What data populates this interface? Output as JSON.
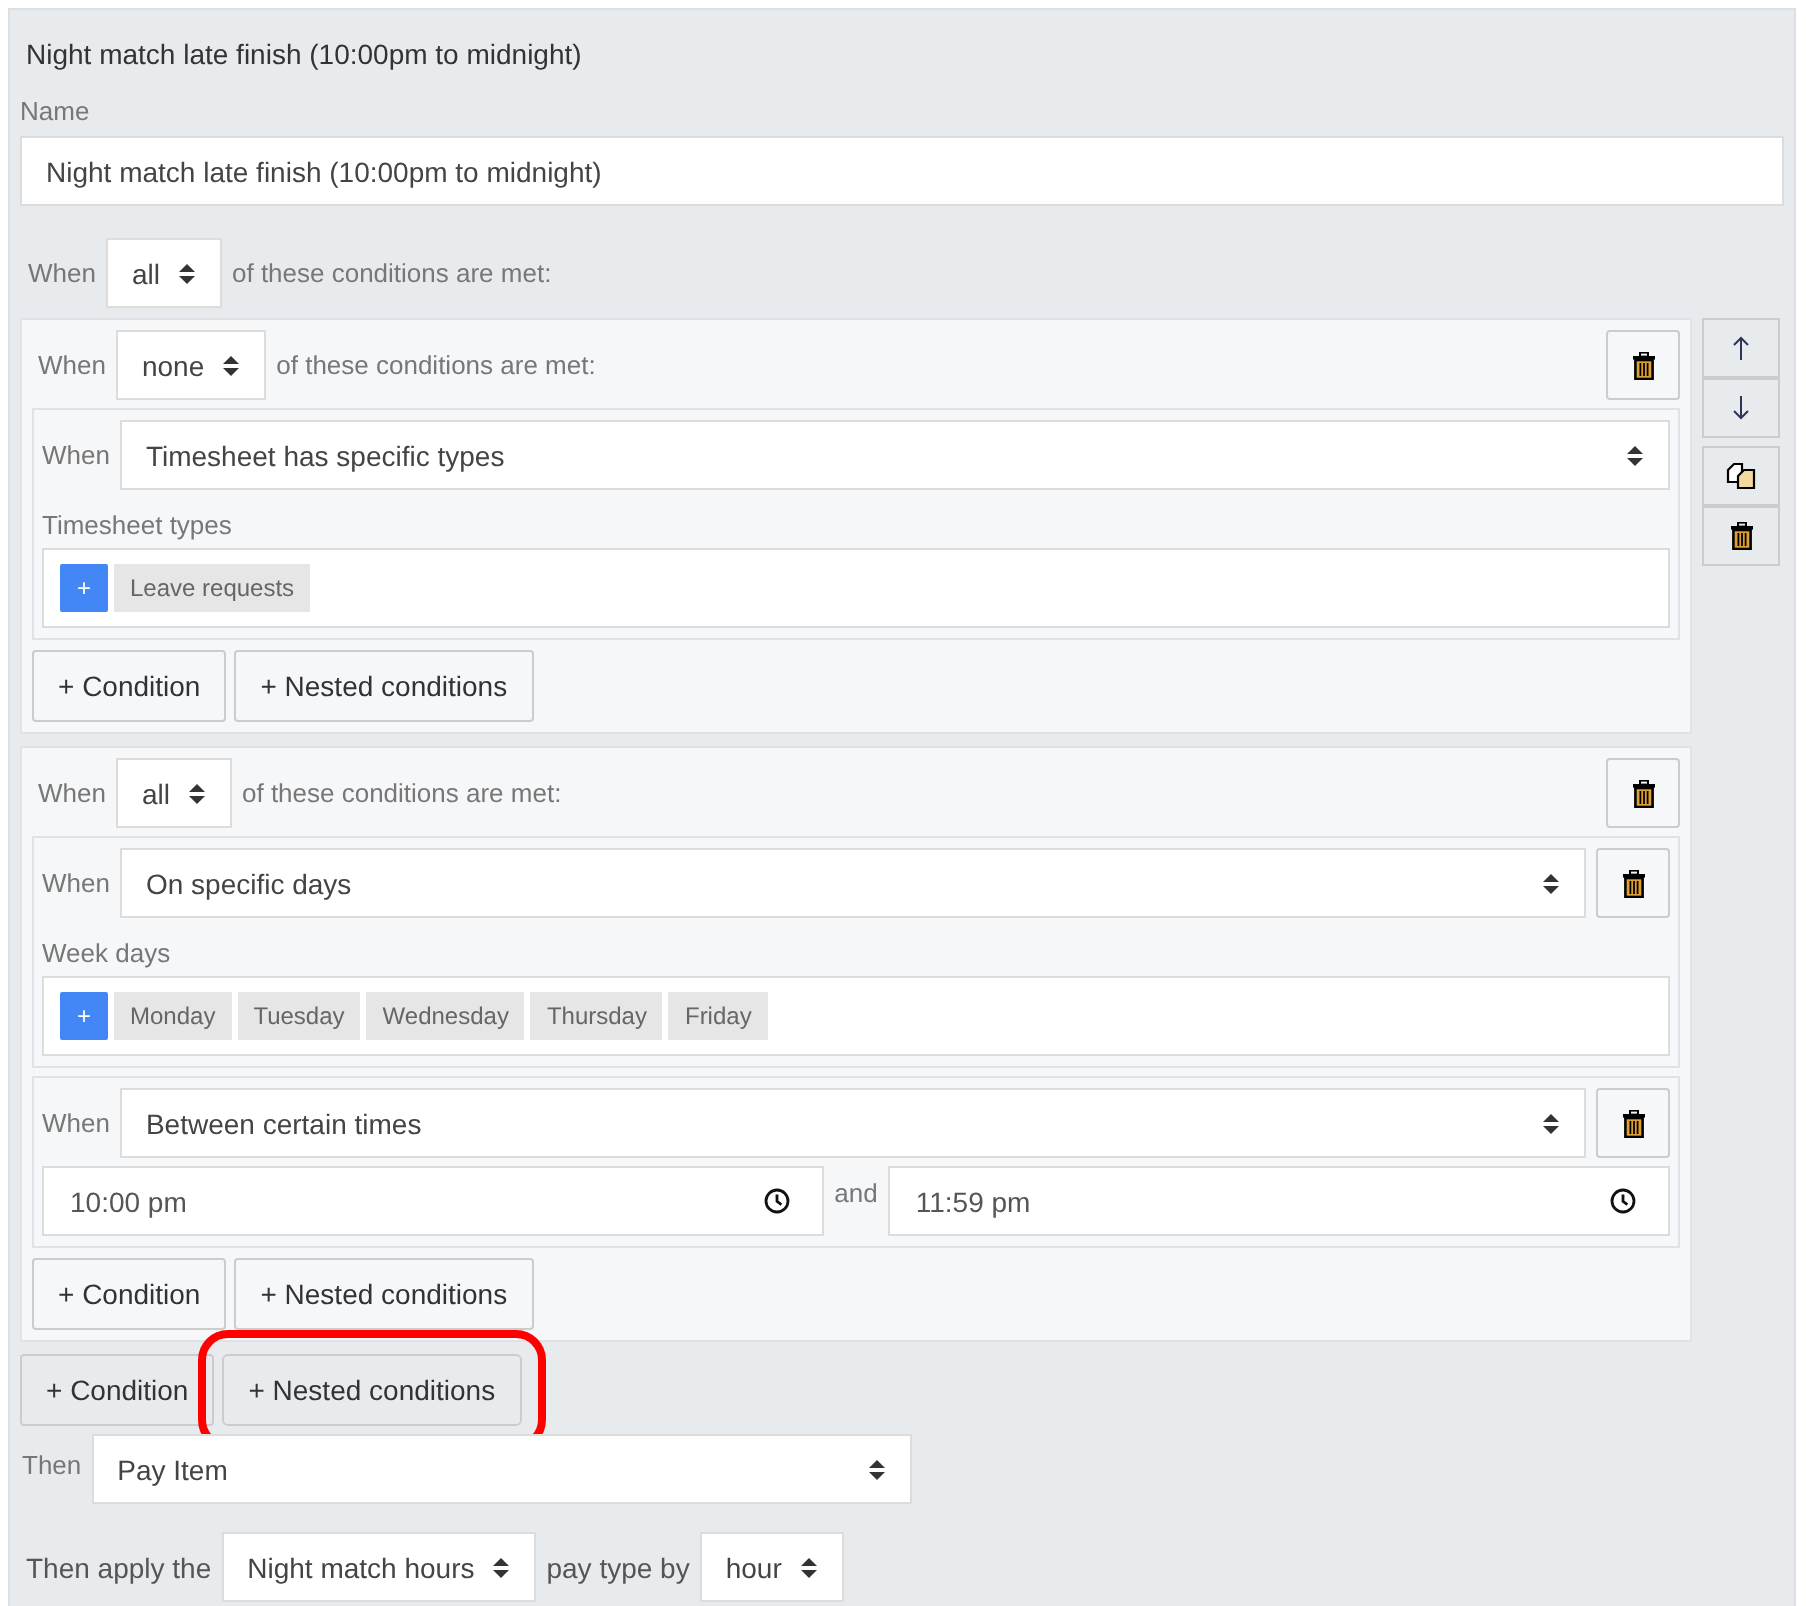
{
  "title": "Night match late finish (10:00pm to midnight)",
  "name": {
    "label": "Name",
    "value": "Night match late finish (10:00pm to midnight)"
  },
  "root": {
    "when": "When",
    "quantifier": "all",
    "suffix": "of these conditions are met:"
  },
  "groups": [
    {
      "when": "When",
      "quantifier": "none",
      "suffix": "of these conditions are met:",
      "conditions": [
        {
          "kind": "list",
          "when": "When",
          "value": "Timesheet has specific types",
          "deletable": false,
          "label": "Timesheet types",
          "add": "+",
          "tags": [
            "Leave requests"
          ]
        }
      ],
      "buttons": [
        {
          "label": "+ Condition",
          "highlighted": false
        },
        {
          "label": "+ Nested conditions",
          "highlighted": false
        }
      ]
    },
    {
      "when": "When",
      "quantifier": "all",
      "suffix": "of these conditions are met:",
      "conditions": [
        {
          "kind": "list",
          "when": "When",
          "value": "On specific days",
          "deletable": true,
          "label": "Week days",
          "add": "+",
          "tags": [
            "Monday",
            "Tuesday",
            "Wednesday",
            "Thursday",
            "Friday"
          ]
        },
        {
          "kind": "times",
          "when": "When",
          "value": "Between certain times",
          "deletable": true,
          "from": "10:00 pm",
          "and": "and",
          "to": "11:59 pm"
        }
      ],
      "buttons": [
        {
          "label": "+ Condition",
          "highlighted": false
        },
        {
          "label": "+ Nested conditions",
          "highlighted": false
        }
      ]
    }
  ],
  "buttons": [
    {
      "label": "+ Condition",
      "highlighted": false
    },
    {
      "label": "+ Nested conditions",
      "highlighted": true
    }
  ],
  "then": {
    "label": "Then",
    "value": "Pay Item"
  },
  "apply": {
    "prefix": "Then apply the",
    "pay_type": "Night match hours",
    "middle": "pay type by",
    "unit": "hour"
  }
}
